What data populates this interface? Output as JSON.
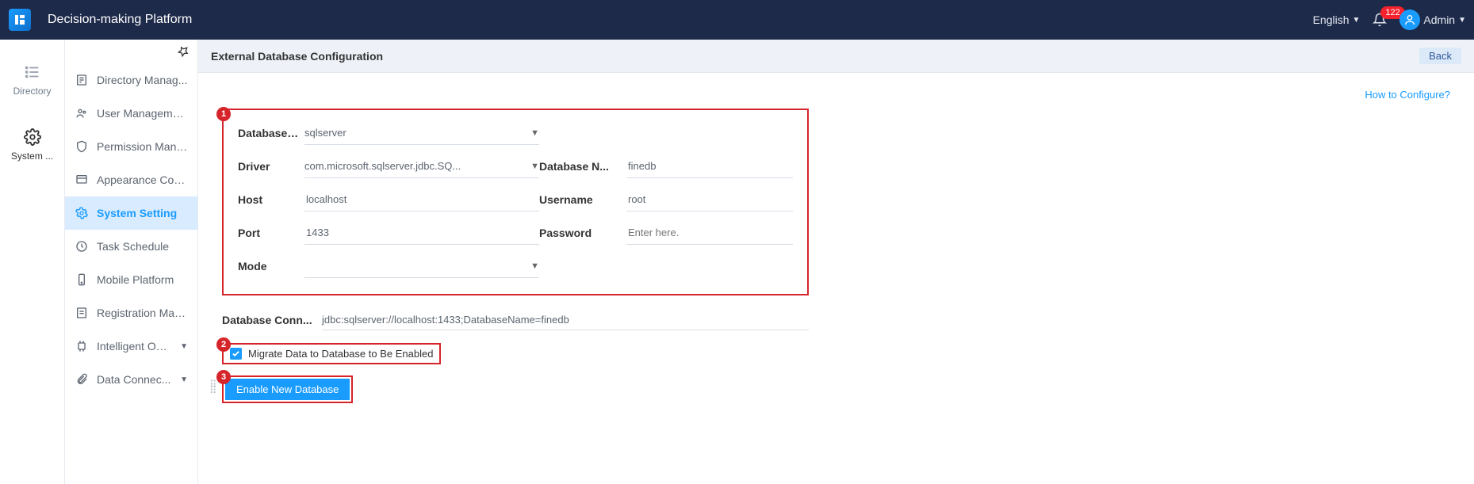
{
  "header": {
    "app_title": "Decision-making Platform",
    "language": "English",
    "notifications": "122",
    "user": "Admin"
  },
  "leftbar": {
    "items": [
      {
        "label": "Directory"
      },
      {
        "label": "System ..."
      }
    ]
  },
  "sidebar": {
    "items": [
      {
        "label": "Directory Manag..."
      },
      {
        "label": "User Management"
      },
      {
        "label": "Permission Mana..."
      },
      {
        "label": "Appearance Conf..."
      },
      {
        "label": "System Setting"
      },
      {
        "label": "Task Schedule"
      },
      {
        "label": "Mobile Platform"
      },
      {
        "label": "Registration Man..."
      },
      {
        "label": "Intelligent O&M"
      },
      {
        "label": "Data Connec..."
      }
    ]
  },
  "page": {
    "title": "External Database Configuration",
    "back": "Back",
    "help": "How to Configure?"
  },
  "form": {
    "db_type_label": "Database T...",
    "db_type_value": "sqlserver",
    "driver_label": "Driver",
    "driver_value": "com.microsoft.sqlserver.jdbc.SQ...",
    "dbname_label": "Database N...",
    "dbname_value": "finedb",
    "host_label": "Host",
    "host_value": "localhost",
    "username_label": "Username",
    "username_value": "root",
    "port_label": "Port",
    "port_value": "1433",
    "password_label": "Password",
    "password_placeholder": "Enter here.",
    "mode_label": "Mode",
    "mode_value": ""
  },
  "conn": {
    "label": "Database Conn...",
    "value": "jdbc:sqlserver://localhost:1433;DatabaseName=finedb"
  },
  "migrate": {
    "label": "Migrate Data to Database to Be Enabled"
  },
  "enable": {
    "label": "Enable New Database"
  },
  "steps": {
    "s1": "1",
    "s2": "2",
    "s3": "3"
  }
}
